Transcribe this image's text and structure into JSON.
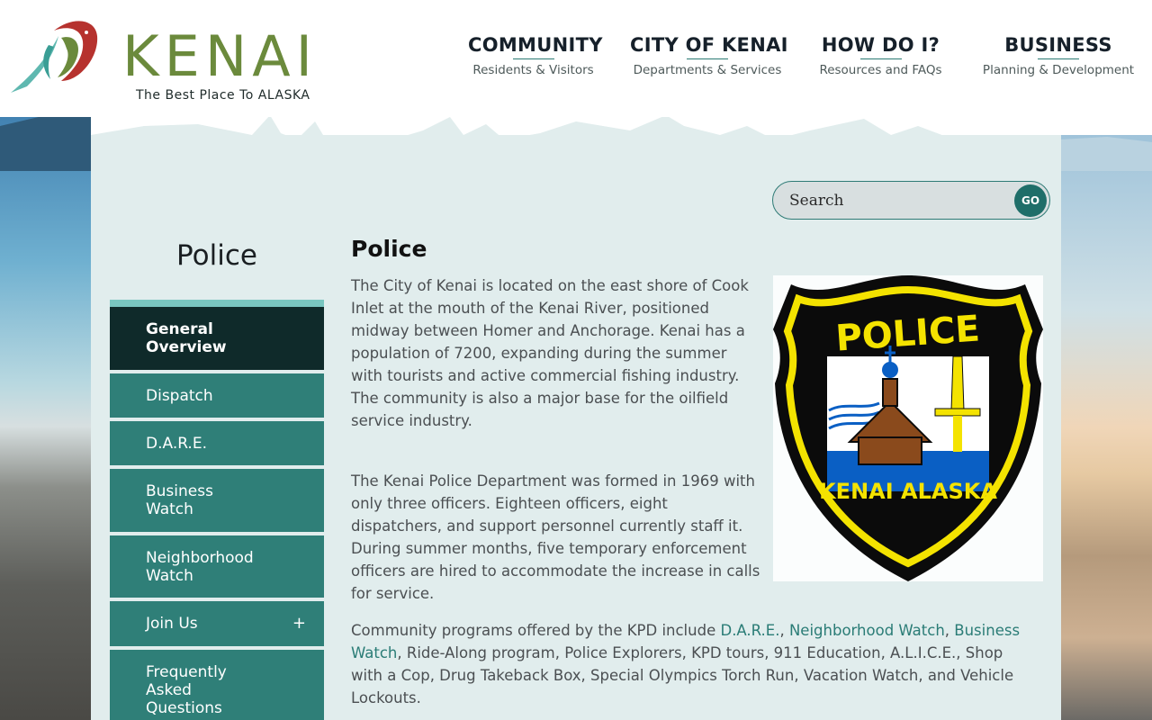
{
  "brand": {
    "name": "KENAI",
    "tagline": "The Best Place To ALASKA"
  },
  "nav": [
    {
      "title": "COMMUNITY",
      "subtitle": "Residents & Visitors"
    },
    {
      "title": "CITY OF KENAI",
      "subtitle": "Departments & Services"
    },
    {
      "title": "HOW DO I?",
      "subtitle": "Resources and FAQs"
    },
    {
      "title": "BUSINESS",
      "subtitle": "Planning & Development"
    }
  ],
  "search": {
    "placeholder": "Search",
    "button_label": "GO"
  },
  "sidebar": {
    "title": "Police",
    "items": [
      {
        "label": "General Overview"
      },
      {
        "label": "Dispatch"
      },
      {
        "label": "D.A.R.E."
      },
      {
        "label": "Business Watch"
      },
      {
        "label": "Neighborhood Watch"
      },
      {
        "label": "Join Us",
        "expand": "+"
      },
      {
        "label": "Frequently Asked Questions"
      }
    ]
  },
  "article": {
    "title": "Police",
    "p1": "The City of Kenai is located on the east shore of Cook Inlet at the mouth of the Kenai River, positioned midway between Homer and Anchorage. Kenai has a population of 7200, expanding during the summer with tourists and active commercial fishing industry. The community is also a major base for the oilfield service industry.",
    "p2": "The Kenai Police Department was formed in 1969 with only three officers. Eighteen officers, eight dispatchers, and support personnel currently staff it. During summer months, five temporary enforcement officers are hired to accommodate the increase in calls for service.",
    "p3": {
      "intro": "Community programs offered by the KPD include ",
      "link1": "D.A.R.E.",
      "sep1": ", ",
      "link2": "Neighborhood Watch",
      "sep2": ", ",
      "link3": "Business Watch",
      "rest": ", Ride-Along program, Police Explorers, KPD tours, 911 Education, A.L.I.C.E., Shop with a Cop, Drug Takeback Box, Special Olympics Torch Run, Vacation Watch, and Vehicle Lockouts."
    }
  },
  "badge": {
    "top_text": "POLICE",
    "bottom_text": "KENAI ALASKA",
    "colors": {
      "black": "#0b0b0b",
      "yellow": "#f4e300",
      "sky": "#ffffff",
      "water": "#0a5fc4",
      "church": "#8a4a1c"
    }
  }
}
